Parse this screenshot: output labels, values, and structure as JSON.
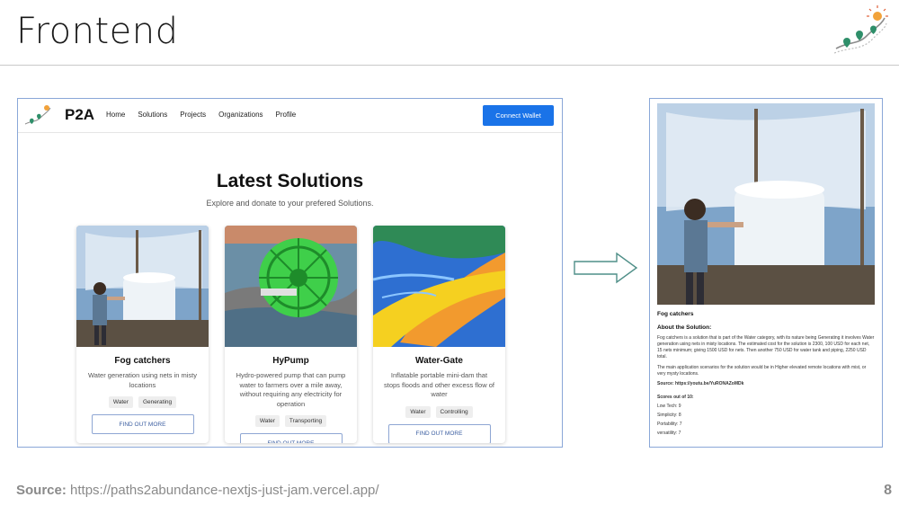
{
  "slide": {
    "title": "Frontend",
    "source_label": "Source:",
    "source_url": "https://paths2abundance-nextjs-just-jam.vercel.app/",
    "page_number": "8"
  },
  "app": {
    "brand": "P2A",
    "nav": [
      "Home",
      "Solutions",
      "Projects",
      "Organizations",
      "Profile"
    ],
    "connect_label": "Connect Wallet",
    "hero_title": "Latest Solutions",
    "hero_subtitle": "Explore and donate to your prefered Solutions.",
    "cards": [
      {
        "title": "Fog catchers",
        "description": "Water generation using nets in misty locations",
        "tags": [
          "Water",
          "Generating"
        ],
        "button": "FIND OUT MORE"
      },
      {
        "title": "HyPump",
        "description": "Hydro-powered pump that can pump water to farmers over a mile away, without requiring any electricity for operation",
        "tags": [
          "Water",
          "Transporting"
        ],
        "button": "FIND OUT MORE"
      },
      {
        "title": "Water-Gate",
        "description": "Inflatable portable mini-dam that stops floods and other excess flow of water",
        "tags": [
          "Water",
          "Controlling"
        ],
        "button": "FIND OUT MORE"
      }
    ]
  },
  "detail": {
    "name": "Fog catchers",
    "about_heading": "About the Solution:",
    "paragraph1": "Fog catchers is a solution that is part of the Water category, with its nature being Generating it involves Water generation using nets in misty locations. The estimated cost for the solution is 2300, 100 USD for each net, 15 nets minimum; giving 1500 USD for nets. Then another 750 USD for water tank and piping, 2250 USD total.",
    "paragraph2": "The main application scenarios for the solution would be in Higher elevated remote locations with mist, or very mysty locations.",
    "source": "Source: https://youtu.be/YuRONAZoMDk",
    "scores_heading": "Scores out of 10:",
    "scores": [
      "Low Tech: 9",
      "Simplicity: 8",
      "Portability: 7",
      "versatility: 7"
    ]
  },
  "colors": {
    "accent": "#1a73e8",
    "frame_border": "#8aa7d8",
    "muted_text": "#8a8a8a"
  }
}
